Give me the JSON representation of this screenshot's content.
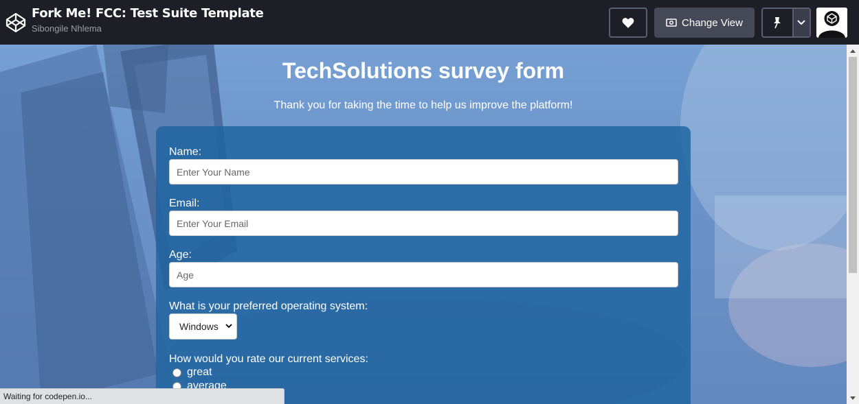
{
  "header": {
    "title": "Fork Me! FCC: Test Suite Template",
    "author": "Sibongile Nhlema",
    "change_view_label": "Change View"
  },
  "survey": {
    "title": "TechSolutions survey form",
    "description": "Thank you for taking the time to help us improve the platform!",
    "name_label": "Name:",
    "name_placeholder": "Enter Your Name",
    "email_label": "Email:",
    "email_placeholder": "Enter Your Email",
    "age_label": "Age:",
    "age_placeholder": "Age",
    "os_label": "What is your preferred operating system:",
    "os_selected": "Windows",
    "rating_label": "How would you rate our current services:",
    "rating_options": [
      "great",
      "average"
    ]
  },
  "status": {
    "text": "Waiting for codepen.io..."
  }
}
